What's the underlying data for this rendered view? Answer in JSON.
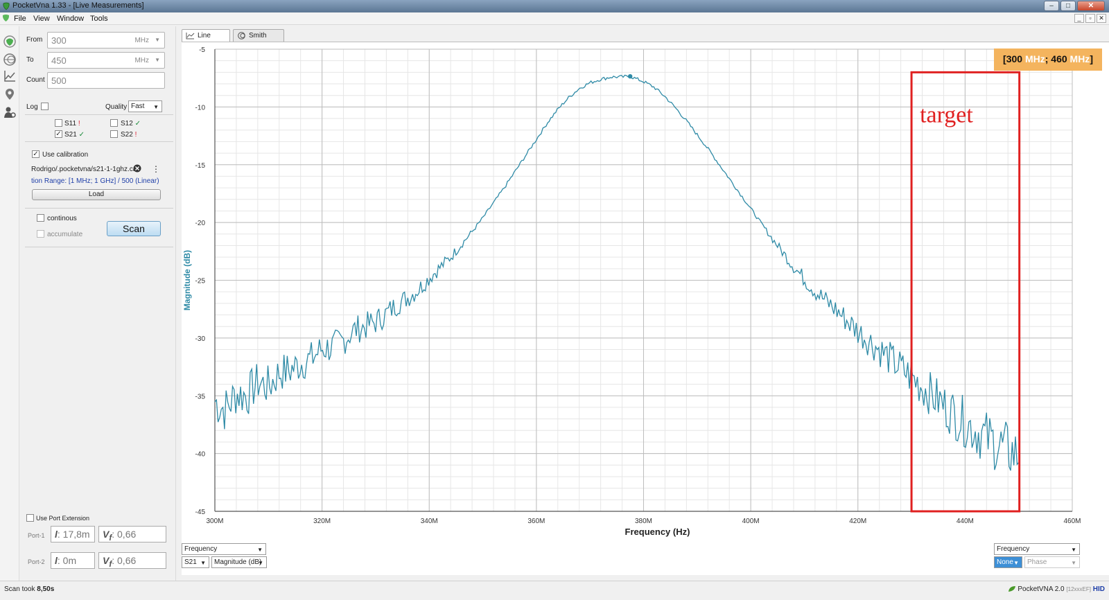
{
  "window": {
    "title": "PocketVna 1.33 - [Live Measurements]"
  },
  "menu": [
    "File",
    "View",
    "Window",
    "Tools"
  ],
  "tabs": [
    "Line Chart",
    "Smith Chart"
  ],
  "sweep": {
    "from_label": "From",
    "from_value": "300",
    "from_unit": "MHz",
    "to_label": "To",
    "to_value": "450",
    "to_unit": "MHz",
    "count_label": "Count",
    "count_value": "500",
    "log_label": "Log",
    "quality_label": "Quality",
    "quality_value": "Fast"
  },
  "sparams": [
    {
      "label": "S11",
      "checked": false,
      "mark": "!",
      "mark_color": "#d23"
    },
    {
      "label": "S12",
      "checked": false,
      "mark": "✓",
      "mark_color": "#1a8a3a"
    },
    {
      "label": "S21",
      "checked": true,
      "mark": "✓",
      "mark_color": "#1a8a3a"
    },
    {
      "label": "S22",
      "checked": false,
      "mark": "!",
      "mark_color": "#d23"
    }
  ],
  "calibration": {
    "use_label": "Use calibration",
    "file": "Rodrigo/.pocketvna/s21-1-1ghz.cali",
    "range_text": "tion Range: [1 MHz; 1 GHz] / 500 (Linear)",
    "load_label": "Load"
  },
  "scan": {
    "continous_label": "continous",
    "accumulate_label": "accumulate",
    "scan_label": "Scan"
  },
  "port_extension": {
    "label": "Use Port Extension",
    "port1_label": "Port-1",
    "port1_length": "17,8m",
    "port1_vf": "0,66",
    "port2_label": "Port-2",
    "port2_length": "0m",
    "port2_vf": "0,66"
  },
  "chart_badge": {
    "open": "[",
    "from": "300",
    "from_unit": "MHz",
    "sep": ";",
    "to": "460",
    "to_unit": "MHz",
    "close": "]"
  },
  "annotation": {
    "label": "target",
    "color": "#e02020"
  },
  "bottom_controls": {
    "left_axis": "Frequency",
    "left_param": "S21",
    "left_mode": "Magnitude (dB)",
    "right_axis": "Frequency",
    "right_param": "None",
    "right_mode": "Phase"
  },
  "status": {
    "scan_took_label": "Scan took",
    "scan_took_value": "8,50s",
    "device": "PocketVNA 2.0",
    "device_id": "[12xxxEF]",
    "device_iface": "HID"
  },
  "chart_data": {
    "type": "line",
    "xlabel": "Frequency (Hz)",
    "ylabel": "Magnitude (dB)",
    "xlim": [
      300,
      460
    ],
    "ylim": [
      -45,
      -5
    ],
    "xticks": [
      "300M",
      "320M",
      "340M",
      "360M",
      "380M",
      "400M",
      "420M",
      "440M",
      "460M"
    ],
    "yticks": [
      "-5",
      "-10",
      "-15",
      "-20",
      "-25",
      "-30",
      "-35",
      "-40",
      "-45"
    ],
    "grid": true,
    "series": [
      {
        "color": "#2e8aa6",
        "x": [
          300,
          302,
          304,
          306,
          308,
          310,
          312,
          314,
          316,
          318,
          320,
          322,
          324,
          326,
          328,
          330,
          332,
          334,
          336,
          338,
          340,
          342,
          344,
          346,
          348,
          350,
          352,
          354,
          356,
          358,
          360,
          362,
          364,
          366,
          368,
          370,
          372,
          374,
          376,
          377.5,
          378,
          380,
          382,
          384,
          386,
          388,
          390,
          392,
          394,
          396,
          398,
          400,
          402,
          404,
          406,
          408,
          410,
          412,
          414,
          416,
          418,
          420,
          422,
          424,
          426,
          428,
          430,
          432,
          434,
          436,
          438,
          440,
          442,
          444,
          446,
          448,
          450
        ],
        "values": [
          -35.5,
          -36.2,
          -34.8,
          -35.0,
          -33.8,
          -34.2,
          -33.0,
          -32.8,
          -32.2,
          -31.8,
          -30.9,
          -30.8,
          -30.2,
          -29.3,
          -29.0,
          -28.6,
          -27.9,
          -27.1,
          -26.5,
          -25.8,
          -24.8,
          -23.9,
          -23.0,
          -21.9,
          -20.8,
          -19.6,
          -18.3,
          -17.0,
          -15.6,
          -14.2,
          -12.8,
          -11.4,
          -10.2,
          -9.2,
          -8.4,
          -7.9,
          -7.6,
          -7.4,
          -7.4,
          -7.35,
          -7.45,
          -7.8,
          -8.3,
          -9.1,
          -10.1,
          -11.2,
          -12.4,
          -13.6,
          -14.9,
          -16.2,
          -17.5,
          -18.8,
          -20.1,
          -21.4,
          -22.6,
          -23.8,
          -24.9,
          -25.9,
          -26.8,
          -27.6,
          -28.5,
          -29.4,
          -30.2,
          -31.0,
          -31.8,
          -32.6,
          -33.4,
          -34.2,
          -35.0,
          -35.8,
          -36.6,
          -37.3,
          -38.0,
          -38.6,
          -39.2,
          -39.7,
          -40.2
        ]
      }
    ],
    "marker": {
      "x": 377.5,
      "y": -7.35
    },
    "highlight_range": [
      430,
      450
    ]
  }
}
